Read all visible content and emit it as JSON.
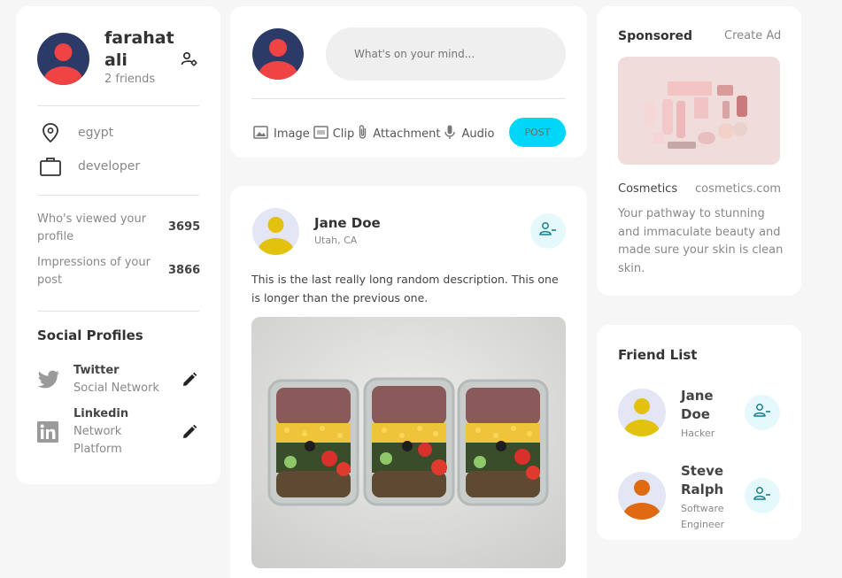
{
  "profile": {
    "name_line1": "farahat",
    "name_line2": "ali",
    "friends": "2 friends",
    "location": "egypt",
    "occupation": "developer",
    "stats": [
      {
        "label_line1": "Who's viewed your",
        "label_line2": "profile",
        "value": "3695"
      },
      {
        "label_line1": "Impressions of your",
        "label_line2": "post",
        "value": "3866"
      }
    ],
    "social_title": "Social Profiles",
    "socials": [
      {
        "name": "Twitter",
        "type_line1": "Social Network",
        "type_line2": ""
      },
      {
        "name": "Linkedin",
        "type_line1": "Network",
        "type_line2": "Platform"
      }
    ]
  },
  "composer": {
    "placeholder": "What's on your mind...",
    "actions": [
      "Image",
      "Clip",
      "Attachment",
      "Audio"
    ],
    "post_button": "POST"
  },
  "post": {
    "author": "Jane Doe",
    "location": "Utah, CA",
    "text_line1": "This is the last really long random description. This one",
    "text_line2": "is longer than the previous one."
  },
  "sponsored": {
    "title": "Sponsored",
    "create_ad": "Create Ad",
    "brand": "Cosmetics",
    "site": "cosmetics.com",
    "desc_lines": [
      "Your pathway to stunning",
      "and immaculate beauty and",
      "made sure your skin is clean",
      "skin."
    ]
  },
  "friends": {
    "title": "Friend List",
    "items": [
      {
        "name_line1": "Jane",
        "name_line2": "Doe",
        "role_line1": "Hacker",
        "role_line2": ""
      },
      {
        "name_line1": "Steve",
        "name_line2": "Ralph",
        "role_line1": "Software",
        "role_line2": "Engineer"
      }
    ]
  },
  "colors": {
    "accent": "#00d5fa",
    "avatar_dark_bg": "#2b3a67",
    "avatar_red": "#f04444",
    "yellow_avatar": "#e2c20e",
    "orange_avatar": "#e06a12"
  }
}
